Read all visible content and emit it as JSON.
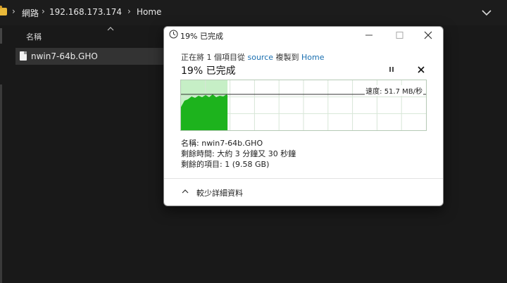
{
  "explorer": {
    "breadcrumbs": [
      "網路",
      "192.168.173.174",
      "Home"
    ],
    "column_name": "名稱",
    "files": [
      {
        "name": "nwin7-64b.GHO"
      }
    ]
  },
  "dialog": {
    "title": "19% 已完成",
    "copy_prefix": "正在將 1 個項目從",
    "source": "source",
    "copy_mid": "複製到",
    "destination": "Home",
    "status": "19% 已完成",
    "progress": 0.19,
    "speed_label": "速度: 51.7 MB/秒",
    "details": [
      {
        "label": "名稱:",
        "value": "nwin7-64b.GHO"
      },
      {
        "label": "剩餘時間:",
        "value": "大約 3 分鐘又 30 秒鐘"
      },
      {
        "label": "剩餘的項目:",
        "value": "1 (9.58 GB)"
      }
    ],
    "less_details": "較少詳細資料"
  },
  "colors": {
    "progress_fill": "#c6efc6",
    "graph_fill": "#1db31d",
    "link": "#1a6fb0"
  }
}
